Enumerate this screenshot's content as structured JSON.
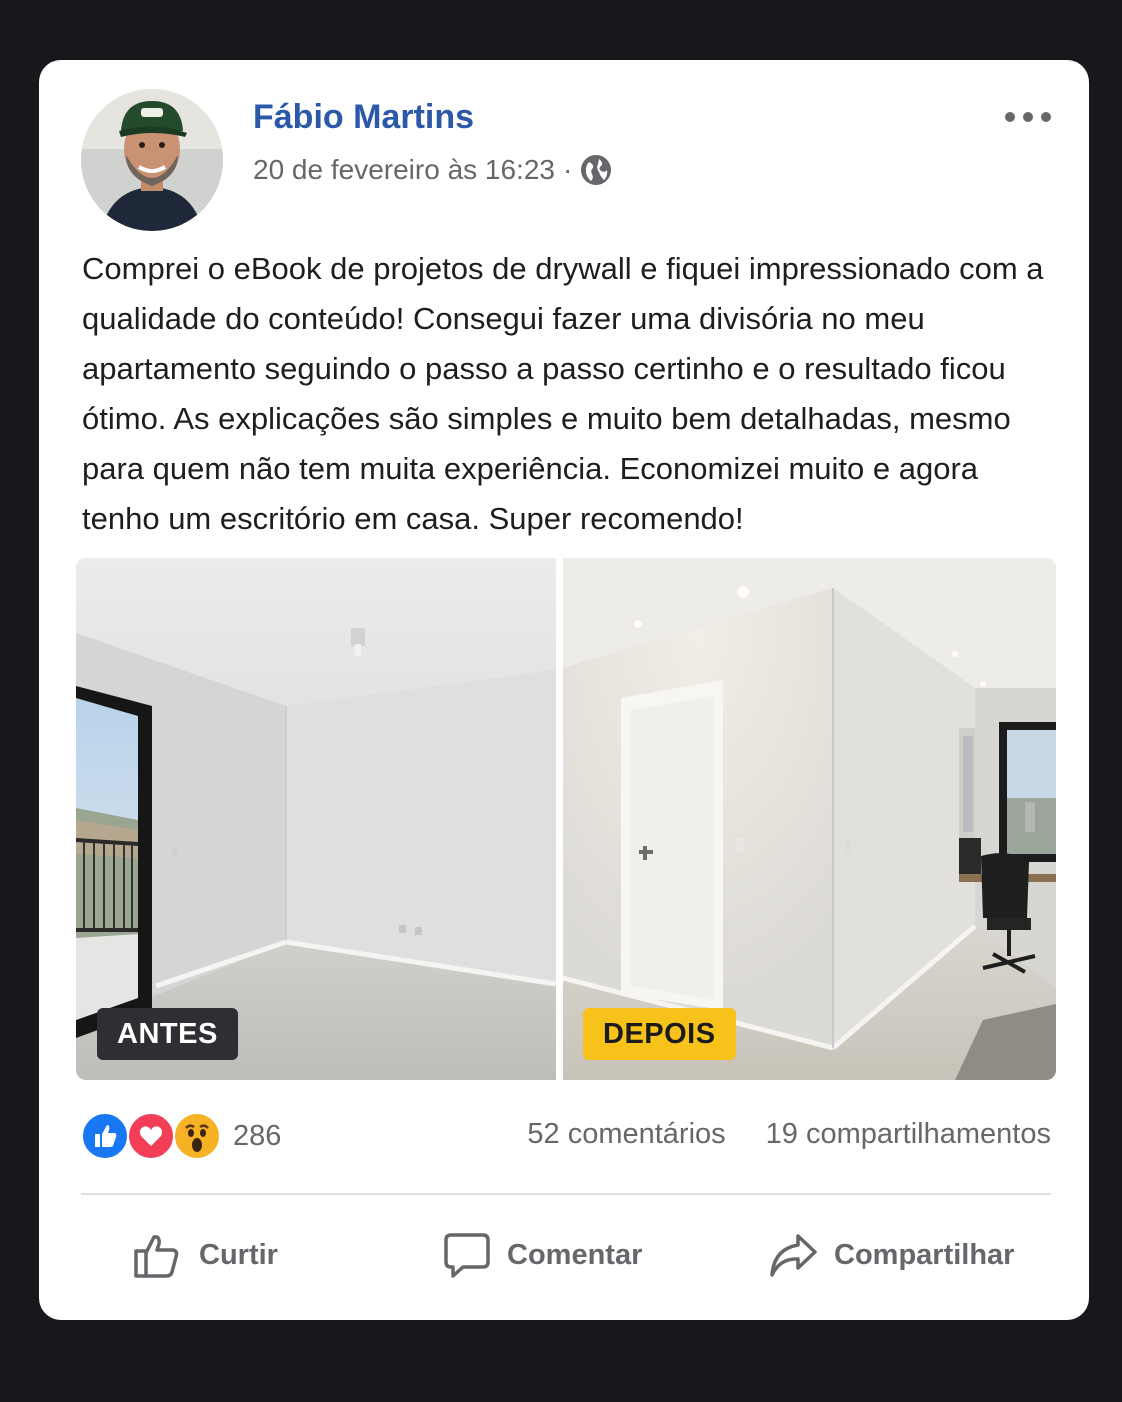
{
  "post": {
    "author": "Fábio Martins",
    "timestamp": "20 de fevereiro às 16:23",
    "separator": "·",
    "privacy_icon": "globe-icon",
    "more_icon": "more-horizontal-icon",
    "text": "Comprei o eBook de projetos de drywall e fiquei impressionado com a qualidade do conteúdo! Consegui fazer uma divisória no meu apartamento seguindo o passo a passo certinho e o resultado ficou ótimo. As explicações são simples e muito bem detalhadas, mesmo para quem não tem muita experiência. Economizei muito e agora tenho um escritório em casa. Super recomendo!"
  },
  "photos": [
    {
      "tag": "ANTES",
      "tag_color": "#2d2f33"
    },
    {
      "tag": "DEPOIS",
      "tag_color": "#f7c31a"
    }
  ],
  "engagement": {
    "reaction_icons": [
      "like-reaction-icon",
      "love-reaction-icon",
      "wow-reaction-icon"
    ],
    "reactions_count": "286",
    "comments": "52 comentários",
    "shares": "19 compartilhamentos"
  },
  "actions": {
    "like": "Curtir",
    "comment": "Comentar",
    "share": "Compartilhar"
  },
  "colors": {
    "author_link": "#2c58a8",
    "secondary_text": "#65676b",
    "like_blue": "#1877f2",
    "love_red": "#f33e58",
    "wow_yellow": "#f7b125"
  }
}
